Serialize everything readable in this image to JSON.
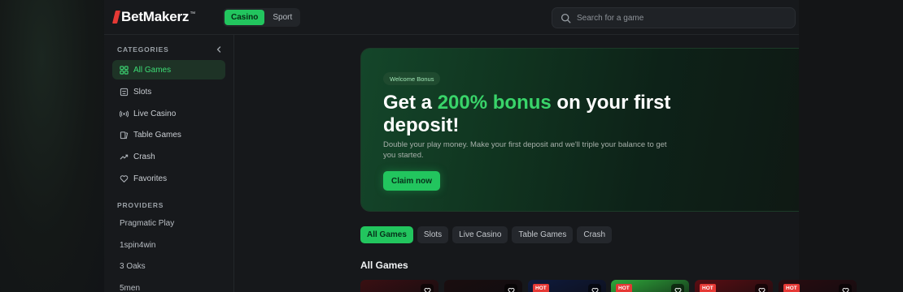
{
  "header": {
    "logo": "BetMakerz",
    "logo_mark": "™",
    "modes": [
      {
        "label": "Casino",
        "active": true
      },
      {
        "label": "Sport",
        "active": false
      }
    ],
    "search": {
      "placeholder": "Search for a game",
      "value": ""
    }
  },
  "sidebar": {
    "categories_title": "CATEGORIES",
    "categories": [
      {
        "label": "All Games",
        "icon": "grid-icon",
        "active": true
      },
      {
        "label": "Slots",
        "icon": "slot-machine-icon",
        "active": false
      },
      {
        "label": "Live Casino",
        "icon": "broadcast-icon",
        "active": false
      },
      {
        "label": "Table Games",
        "icon": "cards-icon",
        "active": false
      },
      {
        "label": "Crash",
        "icon": "trend-up-icon",
        "active": false
      },
      {
        "label": "Favorites",
        "icon": "heart-icon",
        "active": false
      }
    ],
    "providers_title": "PROVIDERS",
    "providers": [
      "Pragmatic Play",
      "1spin4win",
      "3 Oaks",
      "5men"
    ]
  },
  "banner": {
    "badge": "Welcome Bonus",
    "headline_pre": "Get a ",
    "headline_highlight": "200% bonus",
    "headline_post": " on your first deposit!",
    "subtext": "Double your play money. Make your first deposit and we'll triple your balance to get you started.",
    "cta": "Claim now"
  },
  "filters": [
    {
      "label": "All Games",
      "active": true
    },
    {
      "label": "Slots",
      "active": false
    },
    {
      "label": "Live Casino",
      "active": false
    },
    {
      "label": "Table Games",
      "active": false
    },
    {
      "label": "Crash",
      "active": false
    }
  ],
  "games_section": {
    "title": "All Games",
    "cards": [
      {
        "hot": false,
        "badge": "",
        "color": "#3a0f12"
      },
      {
        "hot": false,
        "badge": "",
        "color": "#1a0d0f"
      },
      {
        "hot": true,
        "badge": "HOT",
        "color": "#0f1a3d"
      },
      {
        "hot": true,
        "badge": "HOT",
        "color": "#2fa83a"
      },
      {
        "hot": true,
        "badge": "HOT",
        "color": "#5a0d12"
      },
      {
        "hot": true,
        "badge": "HOT",
        "color": "#2a0c10"
      }
    ]
  },
  "colors": {
    "accent": "#22c55e",
    "brand_red": "#e53935",
    "background": "#121417"
  }
}
